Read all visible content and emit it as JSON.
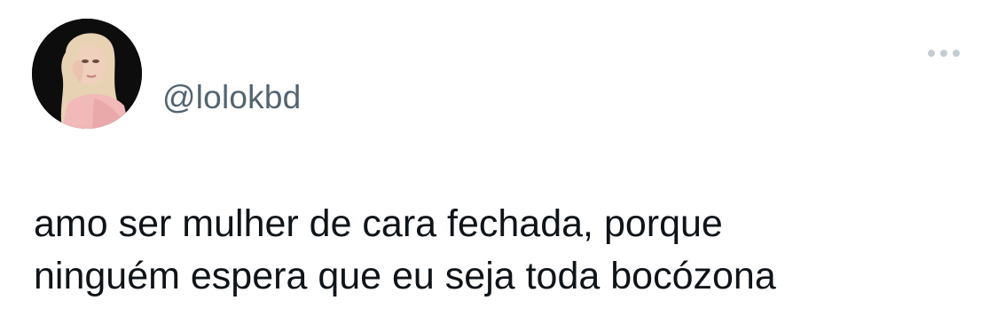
{
  "tweet": {
    "handle": "@lolokbd",
    "text": "amo ser mulher de cara fechada, porque\nninguém espera que eu seja toda bocózona",
    "more_icon": "more-horizontal-icon"
  },
  "colors": {
    "text": "#0f1419",
    "secondary": "#536471",
    "icon": "#c4ccd3",
    "background": "#ffffff"
  }
}
